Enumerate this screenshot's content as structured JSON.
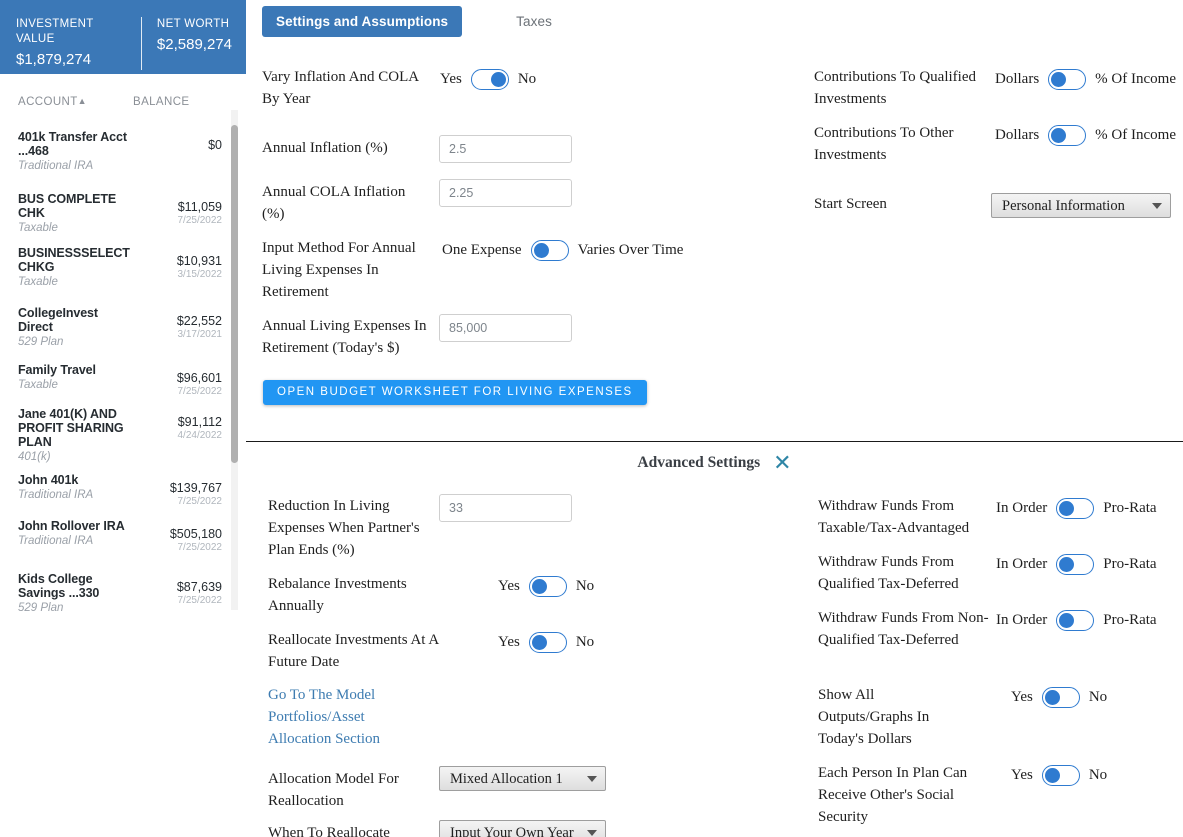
{
  "sidebar": {
    "kpis": [
      {
        "label": "INVESTMENT VALUE",
        "value": "$1,879,274"
      },
      {
        "label": "NET WORTH",
        "value": "$2,589,274"
      }
    ],
    "columns": {
      "account": "ACCOUNT",
      "sort_caret": "▲",
      "balance": "BALANCE"
    },
    "accounts": [
      {
        "name": "401k Transfer Acct ...468",
        "type": "Traditional IRA",
        "balance": "$0",
        "date": ""
      },
      {
        "name": "BUS COMPLETE CHK",
        "type": "Taxable",
        "balance": "$11,059",
        "date": "7/25/2022"
      },
      {
        "name": "BUSINESSSELECT CHKG",
        "type": "Taxable",
        "balance": "$10,931",
        "date": "3/15/2022"
      },
      {
        "name": "CollegeInvest Direct",
        "type": "529 Plan",
        "balance": "$22,552",
        "date": "3/17/2021"
      },
      {
        "name": "Family Travel",
        "type": "Taxable",
        "balance": "$96,601",
        "date": "7/25/2022"
      },
      {
        "name": "Jane 401(K) AND PROFIT SHARING PLAN",
        "type": "401(k)",
        "balance": "$91,112",
        "date": "4/24/2022"
      },
      {
        "name": "John 401k",
        "type": "Traditional IRA",
        "balance": "$139,767",
        "date": "7/25/2022"
      },
      {
        "name": "John Rollover IRA",
        "type": "Traditional IRA",
        "balance": "$505,180",
        "date": "7/25/2022"
      },
      {
        "name": "Kids College Savings ...330",
        "type": "529 Plan",
        "balance": "$87,639",
        "date": "7/25/2022"
      }
    ]
  },
  "tabs": [
    {
      "label": "Settings and Assumptions",
      "active": true
    },
    {
      "label": "Taxes",
      "active": false
    }
  ],
  "settings": {
    "vary_inflation": {
      "label": "Vary Inflation And COLA By Year",
      "option_left": "Yes",
      "option_right": "No",
      "knob": "right"
    },
    "annual_inflation": {
      "label": "Annual Inflation (%)",
      "value": "2.5"
    },
    "annual_cola": {
      "label": "Annual COLA Inflation (%)",
      "value": "2.25"
    },
    "input_method": {
      "label": "Input Method For Annual Living Expenses In Retirement",
      "option_left": "One Expense",
      "option_right": "Varies Over Time",
      "knob": "left"
    },
    "annual_living_expenses": {
      "label": "Annual Living Expenses In Retirement (Today's $)",
      "value": "85,000"
    },
    "budget_button": "OPEN BUDGET WORKSHEET FOR LIVING EXPENSES",
    "contrib_qualified": {
      "label": "Contributions To Qualified Investments",
      "option_left": "Dollars",
      "option_right": "% Of Income",
      "knob": "left"
    },
    "contrib_other": {
      "label": "Contributions To Other Investments",
      "option_left": "Dollars",
      "option_right": "% Of Income",
      "knob": "left"
    },
    "start_screen": {
      "label": "Start Screen",
      "value": "Personal Information"
    }
  },
  "advanced": {
    "title": "Advanced Settings",
    "close_icon": "✕",
    "reduction": {
      "label": "Reduction In Living Expenses When Partner's Plan Ends (%)",
      "value": "33"
    },
    "rebalance": {
      "label": "Rebalance Investments Annually",
      "option_left": "Yes",
      "option_right": "No",
      "knob": "left"
    },
    "reallocate": {
      "label": "Reallocate Investments At A Future Date",
      "option_left": "Yes",
      "option_right": "No",
      "knob": "left"
    },
    "model_link": "Go To The Model Portfolios/Asset Allocation Section",
    "allocation_model": {
      "label": "Allocation Model For Reallocation",
      "value": "Mixed Allocation 1"
    },
    "when_reallocate": {
      "label": "When To Reallocate",
      "value": "Input Your Own Year"
    },
    "withdraw_taxable": {
      "label": "Withdraw Funds From Taxable/Tax-Advantaged",
      "option_left": "In Order",
      "option_right": "Pro-Rata",
      "knob": "left"
    },
    "withdraw_qualified": {
      "label": "Withdraw Funds From Qualified Tax-Deferred",
      "option_left": "In Order",
      "option_right": "Pro-Rata",
      "knob": "left"
    },
    "withdraw_nonqualified": {
      "label": "Withdraw Funds From Non-Qualified Tax-Deferred",
      "option_left": "In Order",
      "option_right": "Pro-Rata",
      "knob": "left"
    },
    "todays_dollars": {
      "label": "Show All Outputs/Graphs In Today's Dollars",
      "option_left": "Yes",
      "option_right": "No",
      "knob": "left"
    },
    "other_social_security": {
      "label": "Each Person In Plan Can Receive Other's Social Security",
      "option_left": "Yes",
      "option_right": "No",
      "knob": "left"
    }
  },
  "colors": {
    "brand_blue": "#3b78b7",
    "toggle_blue": "#2f7bd0",
    "button_blue": "#2196f3",
    "link_blue": "#3e7cb1"
  }
}
